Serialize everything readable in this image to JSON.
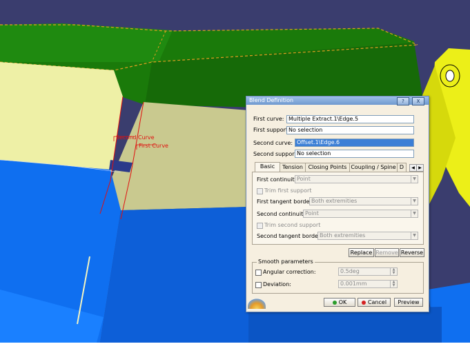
{
  "viewport": {
    "annotations": {
      "second_curve": "Second Curve",
      "first_curve": "First Curve"
    }
  },
  "dialog": {
    "title": "Blend Definition",
    "help_glyph": "?",
    "close_glyph": "X",
    "first_curve": {
      "label": "First curve:",
      "value": "Multiple Extract.1\\Edge.5"
    },
    "first_support": {
      "label": "First support:",
      "value": "No selection"
    },
    "second_curve": {
      "label": "Second curve:",
      "value": "Offset.1\\Edge.6"
    },
    "second_support": {
      "label": "Second support:",
      "value": "No selection"
    },
    "tabs": [
      "Basic",
      "Tension",
      "Closing Points",
      "Coupling / Spine",
      "D"
    ],
    "active_tab": "Basic",
    "basic": {
      "first_continuity": {
        "label": "First continuity:",
        "value": "Point"
      },
      "trim_first_support": "Trim first support",
      "first_tangent_borders": {
        "label": "First tangent borders:",
        "value": "Both extremities"
      },
      "second_continuity": {
        "label": "Second continuity:",
        "value": "Point"
      },
      "trim_second_support": "Trim second support",
      "second_tangent_borders": {
        "label": "Second tangent borders:",
        "value": "Both extremities"
      }
    },
    "actions": {
      "replace": "Replace",
      "remove": "Remove",
      "reverse": "Reverse"
    },
    "smooth": {
      "legend": "Smooth parameters",
      "angular_correction": {
        "label": "Angular correction:",
        "value": "0.5deg"
      },
      "deviation": {
        "label": "Deviation:",
        "value": "0.001mm"
      }
    },
    "footer": {
      "ok": "OK",
      "cancel": "Cancel",
      "preview": "Preview"
    }
  },
  "colors": {
    "green_surface": "#1a7a0a",
    "blue_surface": "#0f6ff0",
    "cream_surface": "#eef0a6",
    "khaki_surface": "#c9c98f",
    "yellow_part": "#ecef18",
    "sky": "#3a3d6e",
    "annotation_red": "#e01010",
    "selection_blue": "#3c7fd6"
  }
}
